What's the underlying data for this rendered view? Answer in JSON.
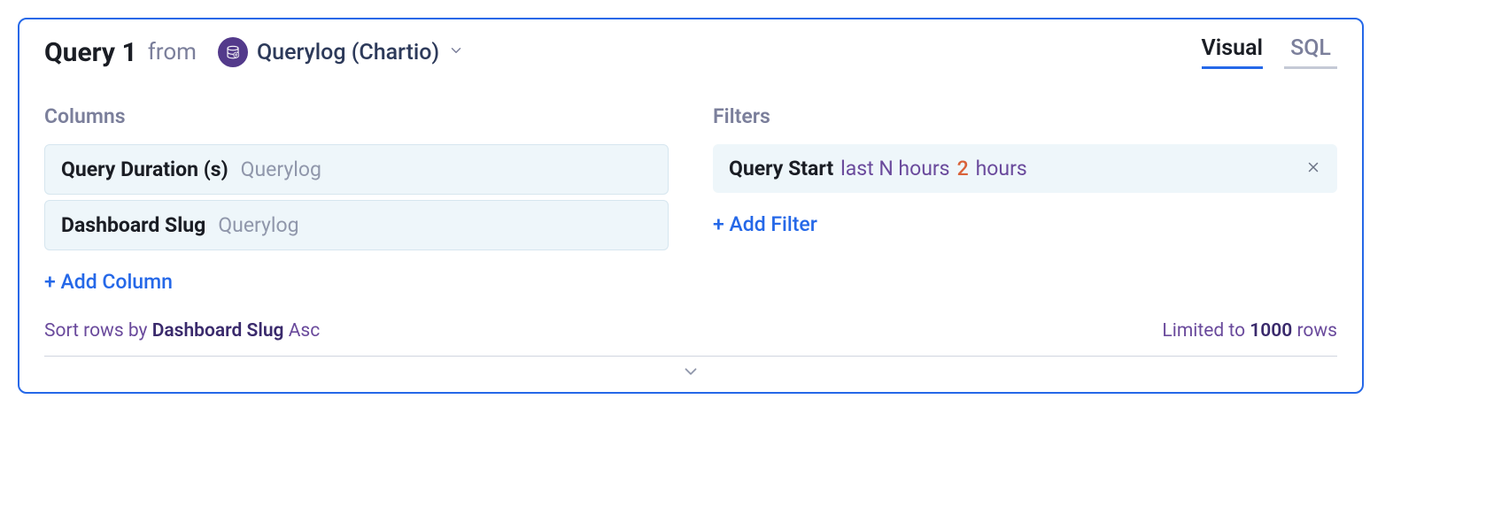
{
  "header": {
    "title": "Query 1",
    "from_label": "from",
    "datasource": "Querylog (Chartio)"
  },
  "tabs": {
    "visual": "Visual",
    "sql": "SQL",
    "active": "visual"
  },
  "columns": {
    "section_title": "Columns",
    "items": [
      {
        "name": "Query Duration (s)",
        "source": "Querylog"
      },
      {
        "name": "Dashboard Slug",
        "source": "Querylog"
      }
    ],
    "add_label": "+ Add Column"
  },
  "filters": {
    "section_title": "Filters",
    "items": [
      {
        "field": "Query Start",
        "operator": "last N hours",
        "value": "2",
        "unit": "hours"
      }
    ],
    "add_label": "+ Add Filter"
  },
  "sort": {
    "prefix": "Sort rows by",
    "field": "Dashboard Slug",
    "direction": "Asc"
  },
  "limit": {
    "prefix": "Limited to",
    "value": "1000",
    "suffix": "rows"
  }
}
